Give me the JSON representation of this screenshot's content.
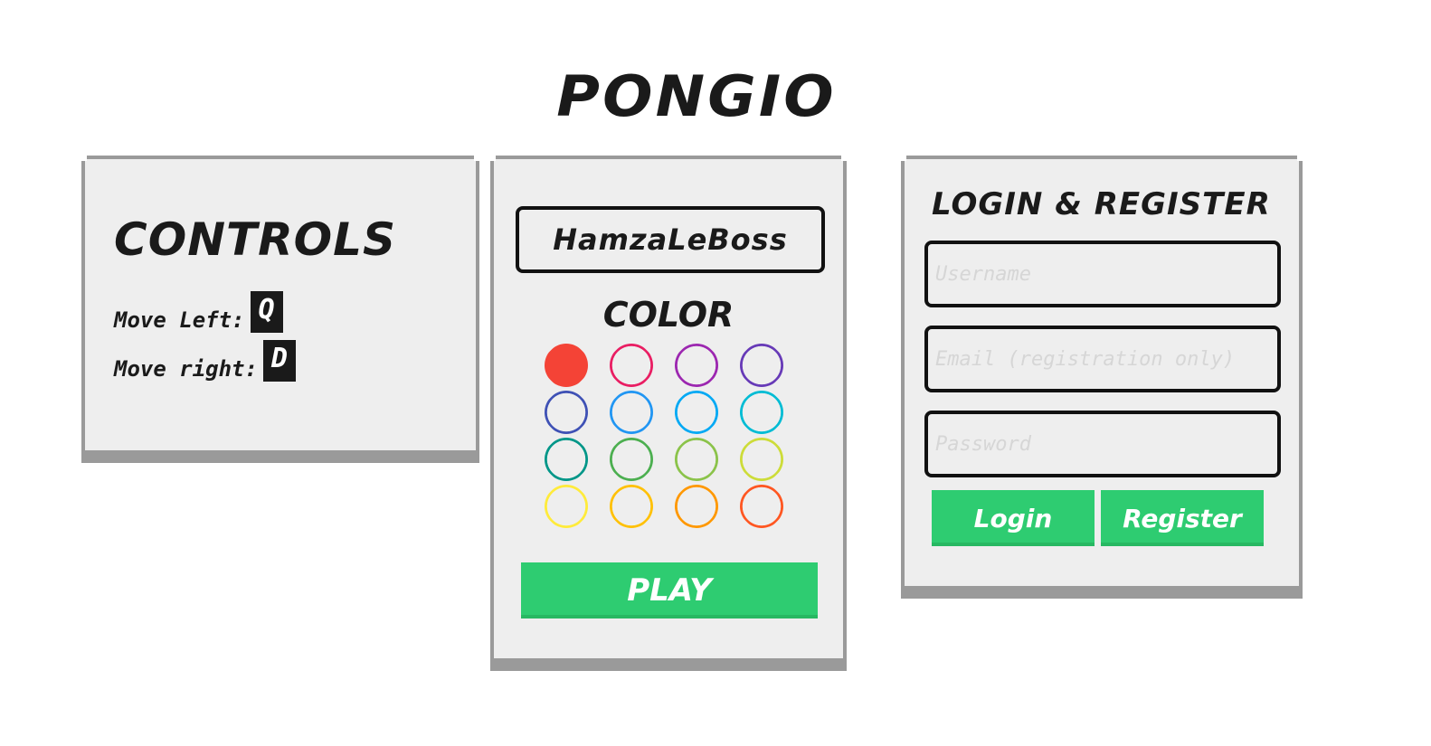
{
  "app": {
    "title": "PONGIO"
  },
  "controls": {
    "title": "CONTROLS",
    "move_left_label": "Move Left:",
    "move_left_key": "Q",
    "move_right_label": "Move right:",
    "move_right_key": "D"
  },
  "player": {
    "name": "HamzaLeBoss",
    "color_title": "COLOR",
    "selected_color_index": 0,
    "colors": [
      "#f44336",
      "#e91e63",
      "#9c27b0",
      "#673ab7",
      "#3f51b5",
      "#2196f3",
      "#03a9f4",
      "#00bcd4",
      "#009688",
      "#4caf50",
      "#8bc34a",
      "#cddc39",
      "#ffeb3b",
      "#ffc107",
      "#ff9800",
      "#ff5722"
    ],
    "play_label": "PLAY"
  },
  "auth": {
    "title": "LOGIN & REGISTER",
    "username_placeholder": "Username",
    "email_placeholder": "Email (registration only)",
    "password_placeholder": "Password",
    "login_label": "Login",
    "register_label": "Register"
  },
  "theme": {
    "accent": "#2ecc71",
    "panel_border": "#9a9a9a"
  }
}
